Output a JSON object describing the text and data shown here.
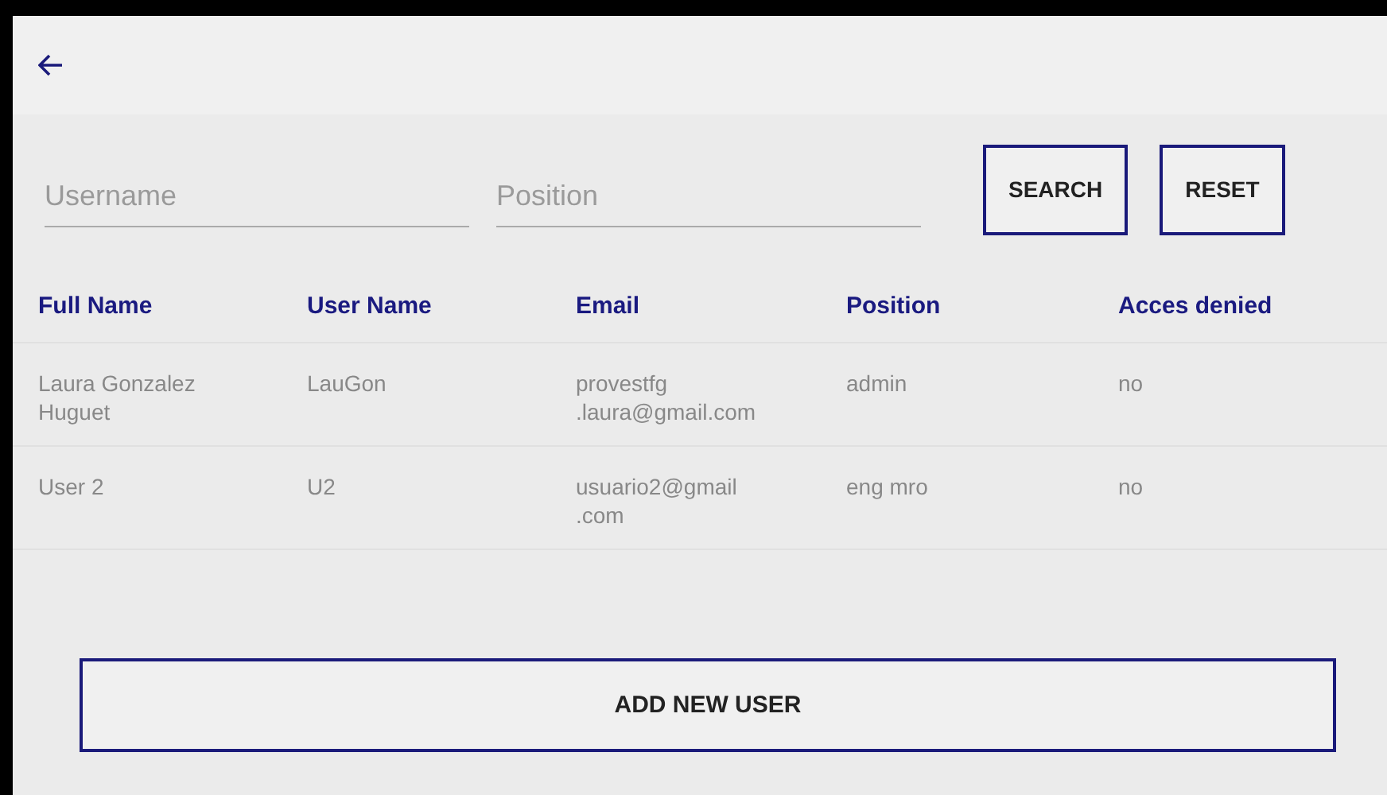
{
  "filters": [
    {
      "placeholder": "Username"
    },
    {
      "placeholder": "Position"
    }
  ],
  "buttons": [
    "SEARCH",
    "RESET"
  ],
  "table": {
    "columns": [
      "Full Name",
      "User Name",
      "Email",
      "Position",
      "Acces denied"
    ],
    "rows": [
      [
        "Laura Gonzalez\nHuguet",
        "LauGon",
        "provestfg\n.laura@gmail.com",
        "admin",
        "no"
      ],
      [
        "User 2",
        "U2",
        "usuario2@gmail\n.com",
        "eng mro",
        "no"
      ]
    ]
  },
  "add_button": "ADD NEW USER"
}
